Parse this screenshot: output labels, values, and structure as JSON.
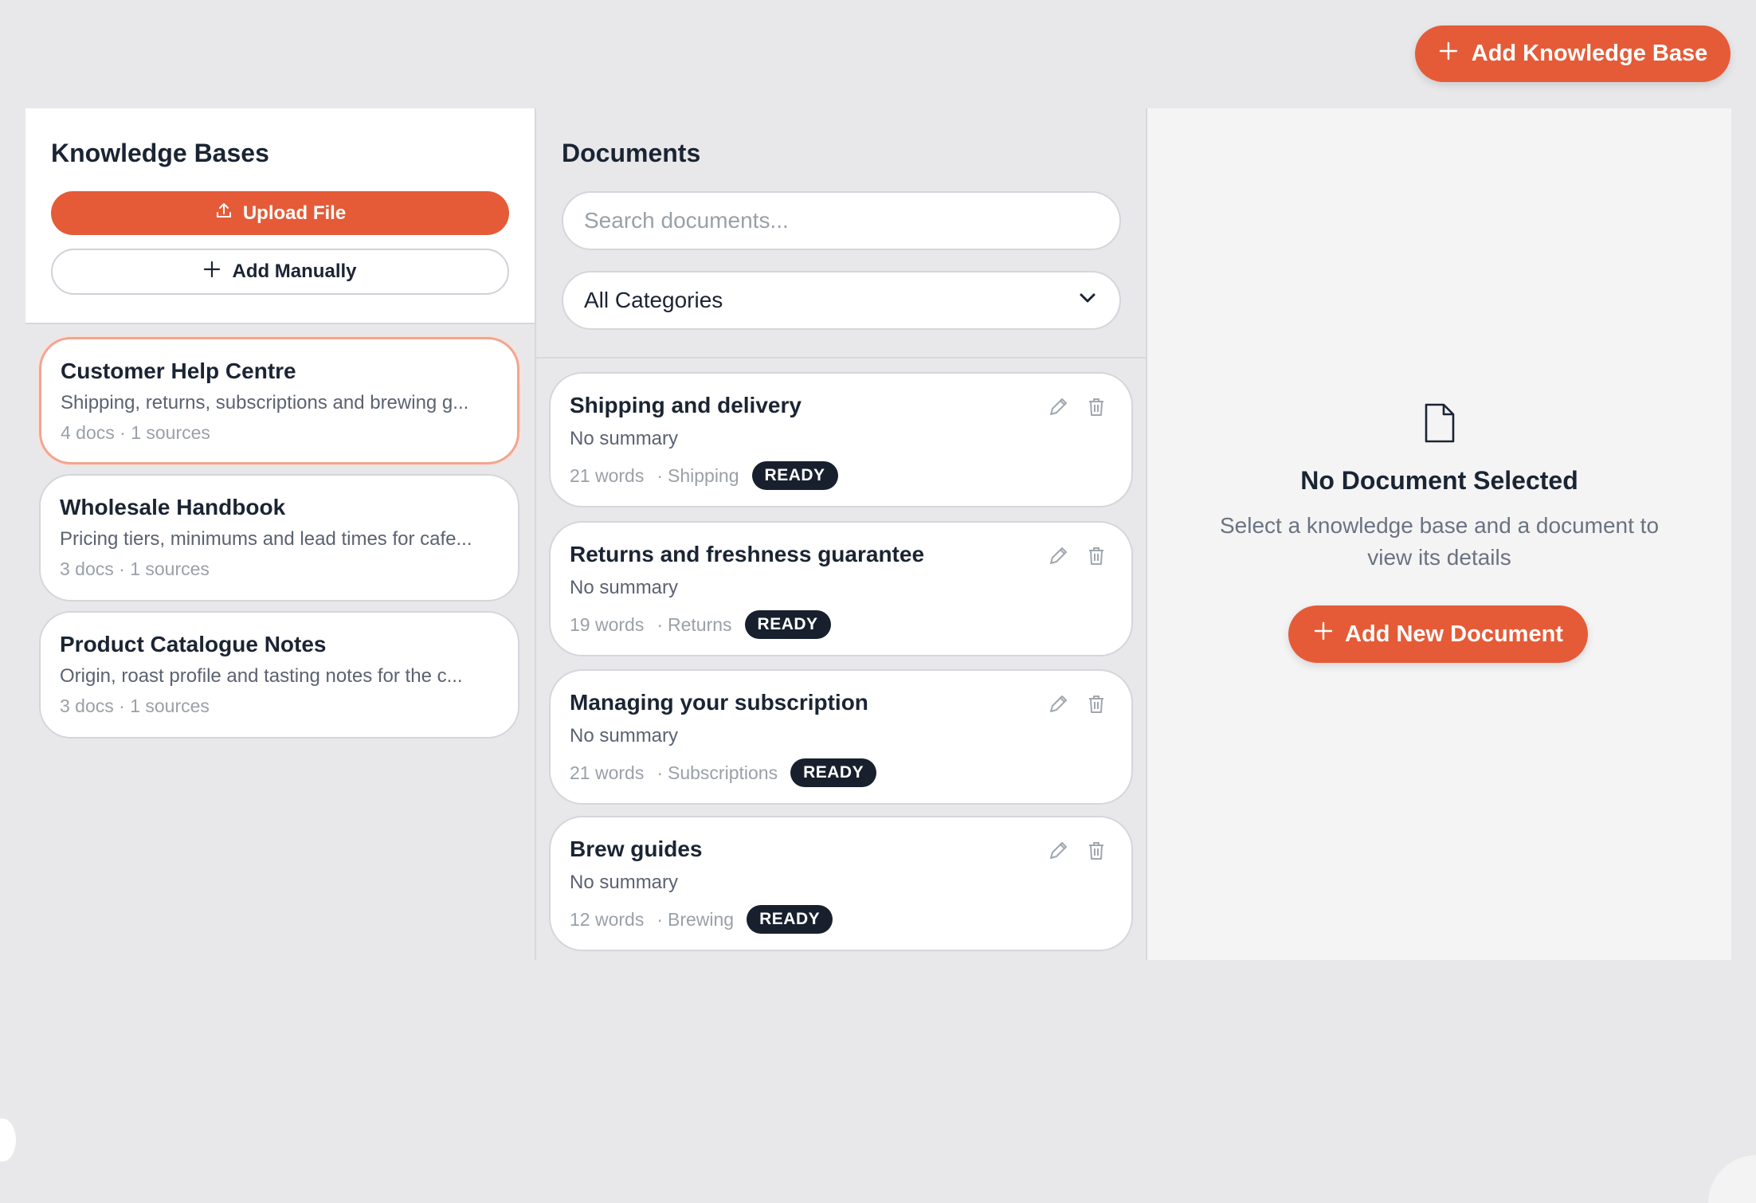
{
  "header": {
    "add_kb_label": "Add Knowledge Base"
  },
  "left": {
    "title": "Knowledge Bases",
    "upload_label": "Upload File",
    "manual_label": "Add Manually",
    "kbs": [
      {
        "name": "Customer Help Centre",
        "desc": "Shipping, returns, subscriptions and brewing g...",
        "meta": "4 docs · 1 sources",
        "selected": true
      },
      {
        "name": "Wholesale Handbook",
        "desc": "Pricing tiers, minimums and lead times for cafe...",
        "meta": "3 docs · 1 sources",
        "selected": false
      },
      {
        "name": "Product Catalogue Notes",
        "desc": "Origin, roast profile and tasting notes for the c...",
        "meta": "3 docs · 1 sources",
        "selected": false
      }
    ]
  },
  "middle": {
    "title": "Documents",
    "search_placeholder": "Search documents...",
    "category_selected": "All Categories",
    "docs": [
      {
        "title": "Shipping and delivery",
        "summary": "No summary",
        "words": "21 words",
        "category": "Shipping",
        "status": "READY"
      },
      {
        "title": "Returns and freshness guarantee",
        "summary": "No summary",
        "words": "19 words",
        "category": "Returns",
        "status": "READY"
      },
      {
        "title": "Managing your subscription",
        "summary": "No summary",
        "words": "21 words",
        "category": "Subscriptions",
        "status": "READY"
      },
      {
        "title": "Brew guides",
        "summary": "No summary",
        "words": "12 words",
        "category": "Brewing",
        "status": "READY"
      }
    ]
  },
  "right": {
    "empty_title": "No Document Selected",
    "empty_line1": "Select a knowledge base and a document to",
    "empty_line2": "view its details",
    "add_doc_label": "Add New Document"
  },
  "colors": {
    "accent": "#e55b37",
    "badge": "#18202e",
    "text": "#1b2433"
  },
  "icons": [
    "plus-icon",
    "upload-icon",
    "chevron-down-icon",
    "pencil-icon",
    "trash-icon",
    "document-icon"
  ]
}
